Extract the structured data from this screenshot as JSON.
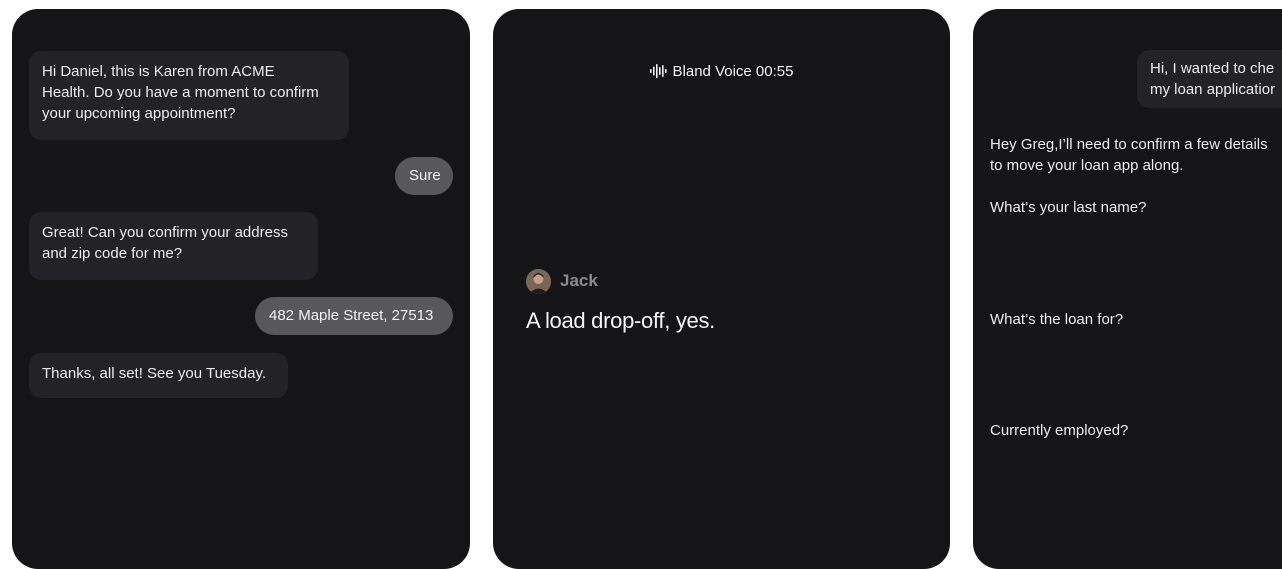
{
  "panel1": {
    "messages": [
      {
        "role": "agent",
        "text": "Hi Daniel, this is Karen from ACME\nHealth. Do you have a moment to confirm\nyour upcoming appointment?"
      },
      {
        "role": "user",
        "text": "Sure"
      },
      {
        "role": "agent",
        "text": "Great! Can you confirm your address\nand zip code for me?"
      },
      {
        "role": "user",
        "text": "482 Maple Street, 27513"
      },
      {
        "role": "agent",
        "text": "Thanks, all set! See you Tuesday."
      }
    ]
  },
  "panel2": {
    "header": "Bland Voice 00:55",
    "speaker": "Jack",
    "transcript": "A load drop-off, yes."
  },
  "panel3": {
    "user_message": "Hi, I wanted to che\nmy loan applicatior",
    "agent_intro": "Hey Greg,I’ll need to confirm a few details\nto move your loan app along.",
    "questions": [
      "What’s your last name?",
      "What’s the loan for?",
      "Currently employed?"
    ]
  }
}
